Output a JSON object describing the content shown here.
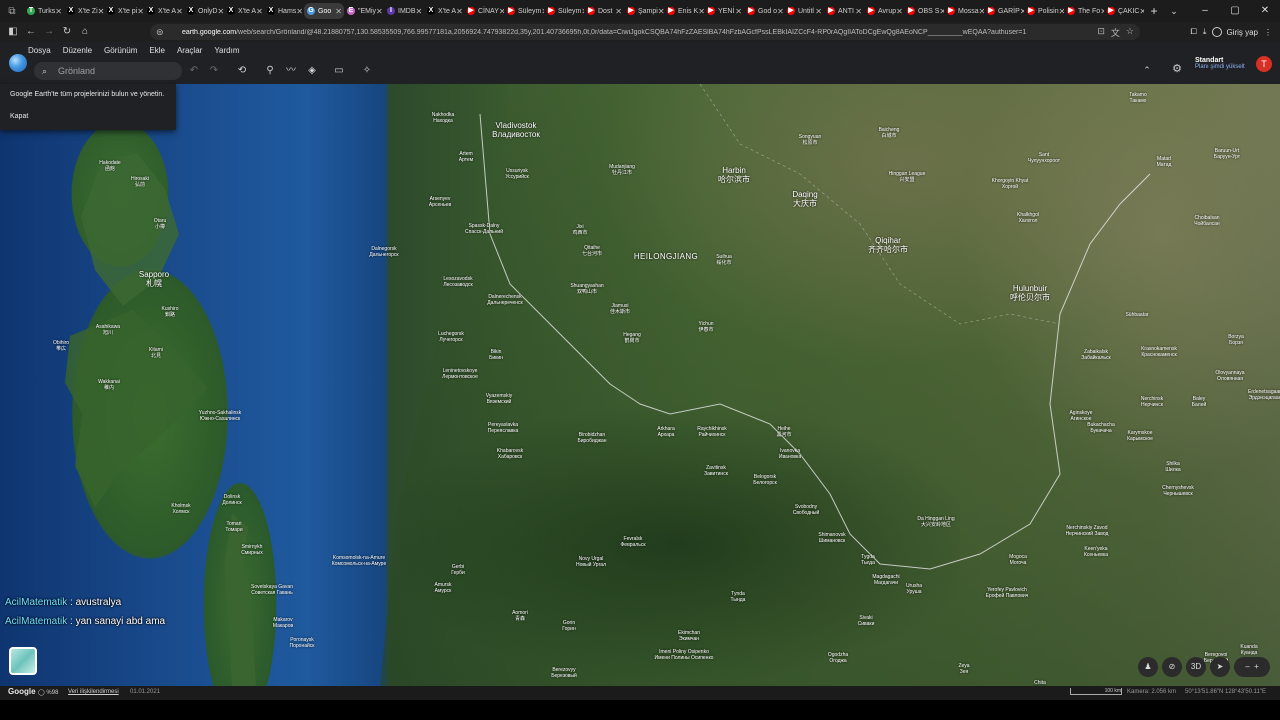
{
  "browser": {
    "tabs": [
      {
        "label": "Turks",
        "color": "#34a853",
        "icon": "T"
      },
      {
        "label": "X'te Zi",
        "color": "#000000",
        "icon": "X"
      },
      {
        "label": "X'te pi",
        "color": "#000000",
        "icon": "X"
      },
      {
        "label": "X'te A",
        "color": "#000000",
        "icon": "X"
      },
      {
        "label": "OnlyD",
        "color": "#000000",
        "icon": "X"
      },
      {
        "label": "X'te A",
        "color": "#000000",
        "icon": "X"
      },
      {
        "label": "Hams",
        "color": "#000000",
        "icon": "X"
      },
      {
        "label": "Goo",
        "color": "#4a9be6",
        "icon": "G",
        "active": true
      },
      {
        "label": "\"EMiy",
        "color": "#cc66cc",
        "icon": "E"
      },
      {
        "label": "IMDB",
        "color": "#5b3aa8",
        "icon": "I"
      },
      {
        "label": "X'te A",
        "color": "#000000",
        "icon": "X"
      },
      {
        "label": "CİNAY",
        "color": "#ff0000",
        "icon": "▶"
      },
      {
        "label": "Süleym",
        "color": "#ff0000",
        "icon": "▶"
      },
      {
        "label": "Süleym",
        "color": "#ff0000",
        "icon": "▶"
      },
      {
        "label": "Dost",
        "color": "#ff0000",
        "icon": "▶"
      },
      {
        "label": "Şampi",
        "color": "#ff0000",
        "icon": "▶"
      },
      {
        "label": "Enis K",
        "color": "#ff0000",
        "icon": "▶"
      },
      {
        "label": "YENİ",
        "color": "#ff0000",
        "icon": "▶"
      },
      {
        "label": "God o",
        "color": "#ff0000",
        "icon": "▶"
      },
      {
        "label": "Untitl",
        "color": "#ff0000",
        "icon": "▶"
      },
      {
        "label": "ANTI",
        "color": "#ff0000",
        "icon": "▶"
      },
      {
        "label": "Avrup",
        "color": "#ff0000",
        "icon": "▶"
      },
      {
        "label": "OBS S",
        "color": "#ff0000",
        "icon": "▶"
      },
      {
        "label": "Mossa",
        "color": "#ff0000",
        "icon": "▶"
      },
      {
        "label": "GARİP",
        "color": "#ff0000",
        "icon": "▶"
      },
      {
        "label": "Polisin",
        "color": "#ff0000",
        "icon": "▶"
      },
      {
        "label": "The Fo",
        "color": "#ff0000",
        "icon": "▶"
      },
      {
        "label": "ÇAKIC",
        "color": "#ff0000",
        "icon": "▶"
      }
    ],
    "url_host": "earth.google.com",
    "url_path": "/web/search/Grönland/@48.21880757,130.58535509,766.99577181a,2056924.74793822d,35y,201.40736695h,0t,0r/data=CiwiJgokCSQBA74hFzZAESlBA74hFzbAGcfPssLEBkIAIZCcF4-RP0rAQgIIAToDCgEwQg8AEoNCP_________wEQAA?authuser=1",
    "signin_label": "Giriş yap"
  },
  "menu": [
    "Dosya",
    "Düzenle",
    "Görünüm",
    "Ekle",
    "Araçlar",
    "Yardım"
  ],
  "earth": {
    "search_value": "Grönland",
    "plan_title": "Standart",
    "plan_link": "Planı şimdi yükselt",
    "user_initial": "T"
  },
  "notice": {
    "text": "Google Earth'te tüm projelerinizi bulun ve yönetin.",
    "close": "Kapat"
  },
  "chat": [
    {
      "user": "AcilMatematik",
      "text": " : avustralya"
    },
    {
      "user": "AcilMatematik",
      "text": " : yan sanayi abd ama"
    }
  ],
  "map_labels": {
    "region": "HEILONGJIANG",
    "cities": [
      {
        "t1": "Vladivostok",
        "t2": "Владивосток"
      },
      {
        "t1": "Harbin",
        "t2": "哈尔滨市"
      },
      {
        "t1": "Daqing",
        "t2": "大庆市"
      },
      {
        "t1": "Qiqihar",
        "t2": "齐齐哈尔市"
      },
      {
        "t1": "Hulunbuir",
        "t2": "呼伦贝尔市"
      },
      {
        "t1": "Sapporo",
        "t2": "札幌"
      }
    ],
    "small": [
      {
        "t1": "Nakhodka",
        "t2": "Находка"
      },
      {
        "t1": "Artem",
        "t2": "Артем"
      },
      {
        "t1": "Ussuriysk",
        "t2": "Уссурийск"
      },
      {
        "t1": "Arsenyev",
        "t2": "Арсеньев"
      },
      {
        "t1": "Spassk-Dalny",
        "t2": "Спасск-Дальний"
      },
      {
        "t1": "Dalnegorsk",
        "t2": "Дальнегорск"
      },
      {
        "t1": "Lesozavodsk",
        "t2": "Лесозаводск"
      },
      {
        "t1": "Dalnerechensk",
        "t2": "Дальнереченск"
      },
      {
        "t1": "Luchegorsk",
        "t2": "Лучегорск"
      },
      {
        "t1": "Bikin",
        "t2": "Бикин"
      },
      {
        "t1": "Leninetovskoye",
        "t2": "Лермонтовское"
      },
      {
        "t1": "Vyazemskiy",
        "t2": "Вяземский"
      },
      {
        "t1": "Pereyaslavka",
        "t2": "Переяславка"
      },
      {
        "t1": "Khabarovsk",
        "t2": "Хабаровск"
      },
      {
        "t1": "Birobidzhan",
        "t2": "Биробиджан"
      },
      {
        "t1": "Arkhara",
        "t2": "Архара"
      },
      {
        "t1": "Raychikhinsk",
        "t2": "Райчихинск"
      },
      {
        "t1": "Heihe",
        "t2": "黑河市"
      },
      {
        "t1": "Ivanovka",
        "t2": "Ивановка"
      },
      {
        "t1": "Zavitinsk",
        "t2": "Завитинск"
      },
      {
        "t1": "Belogorsk",
        "t2": "Белогорск"
      },
      {
        "t1": "Svobodny",
        "t2": "Свободный"
      },
      {
        "t1": "Shimanovsk",
        "t2": "Шимановск"
      },
      {
        "t1": "Da Hinggan Ling",
        "t2": "大兴安岭地区"
      },
      {
        "t1": "Mudanjiang",
        "t2": "牡丹江市"
      },
      {
        "t1": "Jixi",
        "t2": "鸡西市"
      },
      {
        "t1": "Qitaihe",
        "t2": "七台河市"
      },
      {
        "t1": "Shuangyashan",
        "t2": "双鸭山市"
      },
      {
        "t1": "Jiamusi",
        "t2": "佳木斯市"
      },
      {
        "t1": "Hegang",
        "t2": "鹤岗市"
      },
      {
        "t1": "Yichun",
        "t2": "伊春市"
      },
      {
        "t1": "Suihua",
        "t2": "绥化市"
      },
      {
        "t1": "Songyuan",
        "t2": "松原市"
      },
      {
        "t1": "Baicheng",
        "t2": "白城市"
      },
      {
        "t1": "Hinggan League",
        "t2": "兴安盟"
      },
      {
        "t1": "Khorgoyin Khyat",
        "t2": "Хоргой"
      },
      {
        "t1": "Khalkhgol",
        "t2": "Халхгол"
      },
      {
        "t1": "Choibalsan",
        "t2": "Чойбалсан"
      },
      {
        "t1": "Matad",
        "t2": "Матад"
      },
      {
        "t1": "Sant",
        "t2": "Чулуунхороот"
      },
      {
        "t1": "Baruun-Urt",
        "t2": "Баруун-Урт"
      },
      {
        "t1": "Sühbaatar",
        "t2": ""
      },
      {
        "t1": "Zabaikalsk",
        "t2": "Забайкальск"
      },
      {
        "t1": "Krasnokamensk",
        "t2": "Краснокаменск"
      },
      {
        "t1": "Borzya",
        "t2": "Борзя"
      },
      {
        "t1": "Olovyannaya",
        "t2": "Оловянная"
      },
      {
        "t1": "Aginskoye",
        "t2": "Агинское"
      },
      {
        "t1": "Nerchinsk",
        "t2": "Нерчинск"
      },
      {
        "t1": "Baley",
        "t2": "Балей"
      },
      {
        "t1": "Karymskoe",
        "t2": "Карымское"
      },
      {
        "t1": "Shilka",
        "t2": "Шилка"
      },
      {
        "t1": "Chernyshevsk",
        "t2": "Чернышевск"
      },
      {
        "t1": "Bukachacha",
        "t2": "Букачача"
      },
      {
        "t1": "Nerchinskiy Zavod",
        "t2": "Нерчинский Завод"
      },
      {
        "t1": "Keen'yeka",
        "t2": "Ксеньевка"
      },
      {
        "t1": "Mogoca",
        "t2": "Могоча"
      },
      {
        "t1": "Yerofey Pavlovich",
        "t2": "Ерофей Павлович"
      },
      {
        "t1": "Urusha",
        "t2": "Уруша"
      },
      {
        "t1": "Magdagachi",
        "t2": "Магдагачи"
      },
      {
        "t1": "Tygda",
        "t2": "Тыгда"
      },
      {
        "t1": "Sivaki",
        "t2": "Сиваки"
      },
      {
        "t1": "Zeya",
        "t2": "Зея"
      },
      {
        "t1": "Tynda",
        "t2": "Тында"
      },
      {
        "t1": "Fevralsk",
        "t2": "Февральск"
      },
      {
        "t1": "Novy Urgal",
        "t2": "Новый Ургал"
      },
      {
        "t1": "Gerbi",
        "t2": "Герби"
      },
      {
        "t1": "Amursk",
        "t2": "Амурск"
      },
      {
        "t1": "Komsomolsk-na-Amure",
        "t2": "Комсомольск-на-Амуре"
      },
      {
        "t1": "Sovetskaya Gavan",
        "t2": "Советская Гавань"
      },
      {
        "t1": "Makarov",
        "t2": "Макаров"
      },
      {
        "t1": "Poronaysk",
        "t2": "Поронайск"
      },
      {
        "t1": "Smirnykh",
        "t2": "Смирных"
      },
      {
        "t1": "Tomari",
        "t2": "Томари"
      },
      {
        "t1": "Dolinsk",
        "t2": "Долинск"
      },
      {
        "t1": "Kholmsk",
        "t2": "Холмск"
      },
      {
        "t1": "Yuzhno-Sakhalinsk",
        "t2": "Южно-Сахалинск"
      },
      {
        "t1": "Wakkanai",
        "t2": "稚内"
      },
      {
        "t1": "Kitami",
        "t2": "北見"
      },
      {
        "t1": "Asahikawa",
        "t2": "旭川"
      },
      {
        "t1": "Obihiro",
        "t2": "帯広"
      },
      {
        "t1": "Kushiro",
        "t2": "釧路"
      },
      {
        "t1": "Otaru",
        "t2": "小樽"
      },
      {
        "t1": "Hakodate",
        "t2": "函館"
      },
      {
        "t1": "Hirosaki",
        "t2": "弘前"
      },
      {
        "t1": "Aomori",
        "t2": "青森"
      },
      {
        "t1": "Gorin",
        "t2": "Горин"
      },
      {
        "t1": "Berezovyy",
        "t2": "Березовый"
      },
      {
        "t1": "Imeni Poliny Osipenko",
        "t2": "Имени Полины Осипенко"
      },
      {
        "t1": "Ekimchan",
        "t2": "Экимчан"
      },
      {
        "t1": "Ogodzha",
        "t2": "Огоджа"
      },
      {
        "t1": "Beregovoi",
        "t2": "Береговой"
      },
      {
        "t1": "Kuanda",
        "t2": "Куанда"
      },
      {
        "t1": "Takamo",
        "t2": "Такамо"
      },
      {
        "t1": "Erdenetsagaan",
        "t2": "Эрдэнэцагаан"
      },
      {
        "t1": "Chita",
        "t2": "Чита"
      },
      {
        "t1": "Chkalov",
        "t2": ""
      }
    ]
  },
  "status": {
    "brand": "Google",
    "progress": "%98",
    "attribution": "Veri ilişkilendirmesi",
    "date": "01.01.2021",
    "scale": "100 km",
    "camera": "Kamera: 2.056 km",
    "coords": "50°13'51.86\"N 128°43'50.11\"E"
  },
  "controls": {
    "view3d": "3D"
  }
}
